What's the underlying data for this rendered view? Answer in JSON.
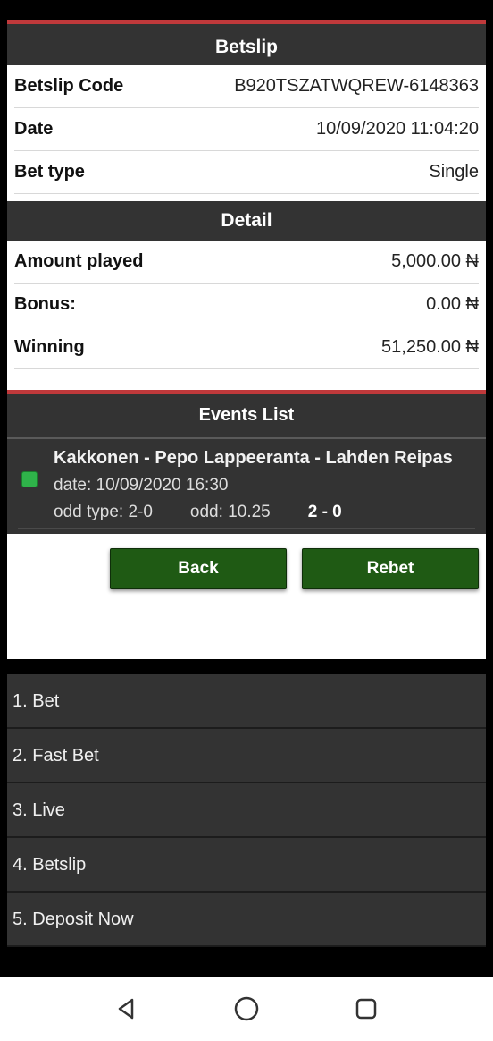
{
  "betslip": {
    "header": "Betslip",
    "rows": [
      {
        "label": "Betslip Code",
        "value": "B920TSZATWQREW-6148363"
      },
      {
        "label": "Date",
        "value": "10/09/2020 11:04:20"
      },
      {
        "label": "Bet type",
        "value": "Single"
      }
    ]
  },
  "detail": {
    "header": "Detail",
    "rows": [
      {
        "label": "Amount played",
        "value": "5,000.00 ₦"
      },
      {
        "label": "Bonus:",
        "value": "0.00 ₦"
      },
      {
        "label": "Winning",
        "value": "51,250.00 ₦"
      }
    ]
  },
  "events": {
    "header": "Events List",
    "items": [
      {
        "title": "Kakkonen - Pepo Lappeeranta - Lahden Reipas",
        "date": "date: 10/09/2020 16:30",
        "odd_type": "odd type: 2-0",
        "odd": "odd: 10.25",
        "score": "2 - 0"
      }
    ]
  },
  "actions": {
    "back_label": "Back",
    "rebet_label": "Rebet"
  },
  "menu": {
    "items": [
      {
        "label": "1. Bet"
      },
      {
        "label": "2. Fast Bet"
      },
      {
        "label": "3. Live"
      },
      {
        "label": "4. Betslip"
      },
      {
        "label": "5. Deposit Now"
      }
    ]
  },
  "navbar": {
    "icons": [
      "back-triangle-icon",
      "home-circle-icon",
      "recent-apps-square-icon"
    ]
  },
  "colors": {
    "accent_red": "#c0393b",
    "header_bg": "#333333",
    "button_green": "#1f5a14",
    "check_green": "#2fb34a"
  }
}
